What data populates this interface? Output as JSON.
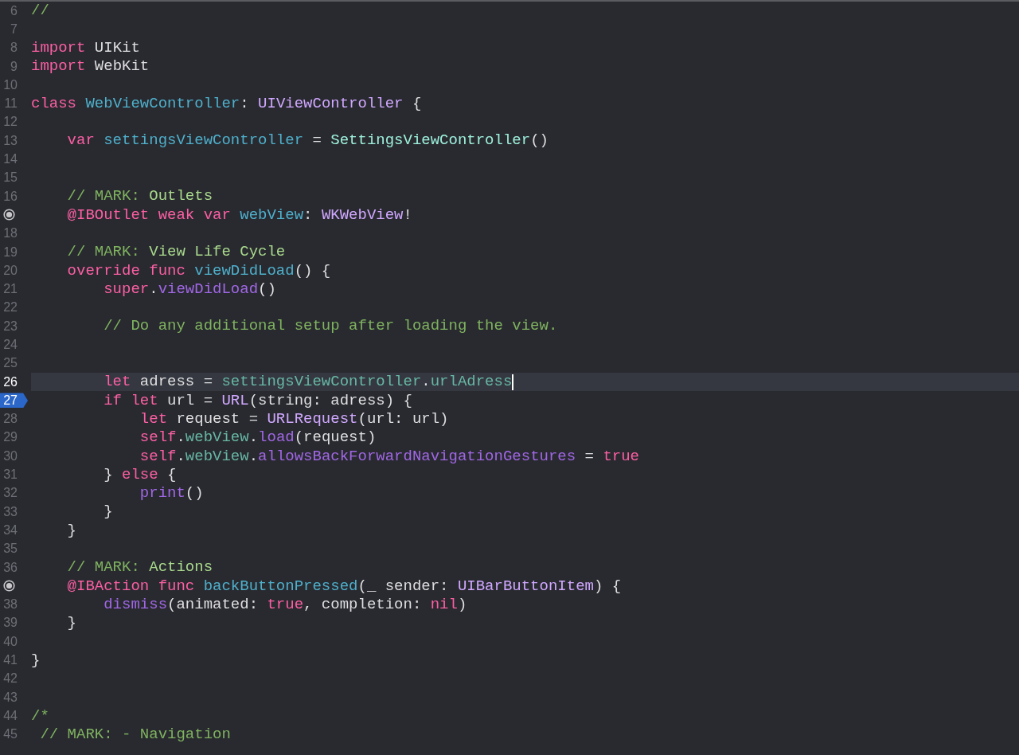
{
  "editor": {
    "lines": [
      {
        "number": "6",
        "tokens": [
          {
            "text": "//",
            "kind": "comment"
          }
        ]
      },
      {
        "number": "7"
      },
      {
        "number": "8",
        "tokens": [
          {
            "text": "import",
            "kind": "keyword"
          },
          {
            "text": " UIKit",
            "kind": "plain"
          }
        ]
      },
      {
        "number": "9",
        "tokens": [
          {
            "text": "import",
            "kind": "keyword"
          },
          {
            "text": " WebKit",
            "kind": "plain"
          }
        ]
      },
      {
        "number": "10"
      },
      {
        "number": "11",
        "tokens": [
          {
            "text": "class ",
            "kind": "keyword"
          },
          {
            "text": "WebViewController",
            "kind": "declaration"
          },
          {
            "text": ": ",
            "kind": "plain"
          },
          {
            "text": "UIViewController",
            "kind": "type"
          },
          {
            "text": " {",
            "kind": "plain"
          }
        ]
      },
      {
        "number": "12"
      },
      {
        "number": "13",
        "tokens": [
          {
            "text": "    var ",
            "kind": "keyword"
          },
          {
            "text": "settingsViewController",
            "kind": "declaration"
          },
          {
            "text": " = ",
            "kind": "plain"
          },
          {
            "text": "SettingsViewController",
            "kind": "project_type"
          },
          {
            "text": "()",
            "kind": "plain"
          }
        ]
      },
      {
        "number": "14"
      },
      {
        "number": "15"
      },
      {
        "number": "16",
        "tokens": [
          {
            "text": "    // MARK: ",
            "kind": "comment"
          },
          {
            "text": "Outlets",
            "kind": "mark"
          }
        ]
      },
      {
        "connected": true,
        "tokens": [
          {
            "text": "    @IBOutlet weak var ",
            "kind": "keyword"
          },
          {
            "text": "webView",
            "kind": "declaration"
          },
          {
            "text": ": ",
            "kind": "plain"
          },
          {
            "text": "WKWebView",
            "kind": "type"
          },
          {
            "text": "!",
            "kind": "plain"
          }
        ]
      },
      {
        "number": "18"
      },
      {
        "number": "19",
        "tokens": [
          {
            "text": "    // MARK: ",
            "kind": "comment"
          },
          {
            "text": "View Life Cycle",
            "kind": "mark"
          }
        ]
      },
      {
        "number": "20",
        "tokens": [
          {
            "text": "    override func ",
            "kind": "keyword"
          },
          {
            "text": "viewDidLoad",
            "kind": "declaration"
          },
          {
            "text": "() {",
            "kind": "plain"
          }
        ]
      },
      {
        "number": "21",
        "tokens": [
          {
            "text": "        super",
            "kind": "keyword"
          },
          {
            "text": ".",
            "kind": "plain"
          },
          {
            "text": "viewDidLoad",
            "kind": "method"
          },
          {
            "text": "()",
            "kind": "plain"
          }
        ]
      },
      {
        "number": "22"
      },
      {
        "number": "23",
        "tokens": [
          {
            "text": "        // Do any additional setup after loading the view.",
            "kind": "comment"
          }
        ]
      },
      {
        "number": "24"
      },
      {
        "number": "25"
      },
      {
        "number": "26",
        "current": true,
        "cursor": true,
        "tokens": [
          {
            "text": "        let",
            "kind": "keyword"
          },
          {
            "text": " adress = ",
            "kind": "plain"
          },
          {
            "text": "settingsViewController",
            "kind": "project_ref"
          },
          {
            "text": ".",
            "kind": "plain"
          },
          {
            "text": "urlAdress",
            "kind": "project_ref"
          }
        ]
      },
      {
        "number": "27",
        "breakpoint": true,
        "tokens": [
          {
            "text": "        if let",
            "kind": "keyword"
          },
          {
            "text": " url = ",
            "kind": "plain"
          },
          {
            "text": "URL",
            "kind": "type"
          },
          {
            "text": "(string: adress) {",
            "kind": "plain"
          }
        ]
      },
      {
        "number": "28",
        "tokens": [
          {
            "text": "            let",
            "kind": "keyword"
          },
          {
            "text": " request = ",
            "kind": "plain"
          },
          {
            "text": "URLRequest",
            "kind": "type"
          },
          {
            "text": "(url: url)",
            "kind": "plain"
          }
        ]
      },
      {
        "number": "29",
        "tokens": [
          {
            "text": "            self",
            "kind": "keyword"
          },
          {
            "text": ".",
            "kind": "plain"
          },
          {
            "text": "webView",
            "kind": "project_ref"
          },
          {
            "text": ".",
            "kind": "plain"
          },
          {
            "text": "load",
            "kind": "method"
          },
          {
            "text": "(request)",
            "kind": "plain"
          }
        ]
      },
      {
        "number": "30",
        "tokens": [
          {
            "text": "            self",
            "kind": "keyword"
          },
          {
            "text": ".",
            "kind": "plain"
          },
          {
            "text": "webView",
            "kind": "project_ref"
          },
          {
            "text": ".",
            "kind": "plain"
          },
          {
            "text": "allowsBackForwardNavigationGestures",
            "kind": "method"
          },
          {
            "text": " = ",
            "kind": "plain"
          },
          {
            "text": "true",
            "kind": "keyword"
          }
        ]
      },
      {
        "number": "31",
        "tokens": [
          {
            "text": "        } ",
            "kind": "plain"
          },
          {
            "text": "else",
            "kind": "keyword"
          },
          {
            "text": " {",
            "kind": "plain"
          }
        ]
      },
      {
        "number": "32",
        "tokens": [
          {
            "text": "            print",
            "kind": "method"
          },
          {
            "text": "()",
            "kind": "plain"
          }
        ]
      },
      {
        "number": "33",
        "tokens": [
          {
            "text": "        }",
            "kind": "plain"
          }
        ]
      },
      {
        "number": "34",
        "tokens": [
          {
            "text": "    }",
            "kind": "plain"
          }
        ]
      },
      {
        "number": "35"
      },
      {
        "number": "36",
        "tokens": [
          {
            "text": "    // MARK: ",
            "kind": "comment"
          },
          {
            "text": "Actions",
            "kind": "mark"
          }
        ]
      },
      {
        "connected": true,
        "tokens": [
          {
            "text": "    @IBAction func ",
            "kind": "keyword"
          },
          {
            "text": "backButtonPressed",
            "kind": "declaration"
          },
          {
            "text": "(_ sender: ",
            "kind": "plain"
          },
          {
            "text": "UIBarButtonItem",
            "kind": "type"
          },
          {
            "text": ") {",
            "kind": "plain"
          }
        ]
      },
      {
        "number": "38",
        "tokens": [
          {
            "text": "        dismiss",
            "kind": "method"
          },
          {
            "text": "(animated: ",
            "kind": "plain"
          },
          {
            "text": "true",
            "kind": "keyword"
          },
          {
            "text": ", completion: ",
            "kind": "plain"
          },
          {
            "text": "nil",
            "kind": "keyword"
          },
          {
            "text": ")",
            "kind": "plain"
          }
        ]
      },
      {
        "number": "39",
        "tokens": [
          {
            "text": "    }",
            "kind": "plain"
          }
        ]
      },
      {
        "number": "40"
      },
      {
        "number": "41",
        "tokens": [
          {
            "text": "}",
            "kind": "plain"
          }
        ]
      },
      {
        "number": "42"
      },
      {
        "number": "43"
      },
      {
        "number": "44",
        "tokens": [
          {
            "text": "/*",
            "kind": "comment"
          }
        ]
      },
      {
        "number": "45",
        "tokens": [
          {
            "text": " // MARK: - Navigation",
            "kind": "comment"
          }
        ]
      }
    ]
  }
}
